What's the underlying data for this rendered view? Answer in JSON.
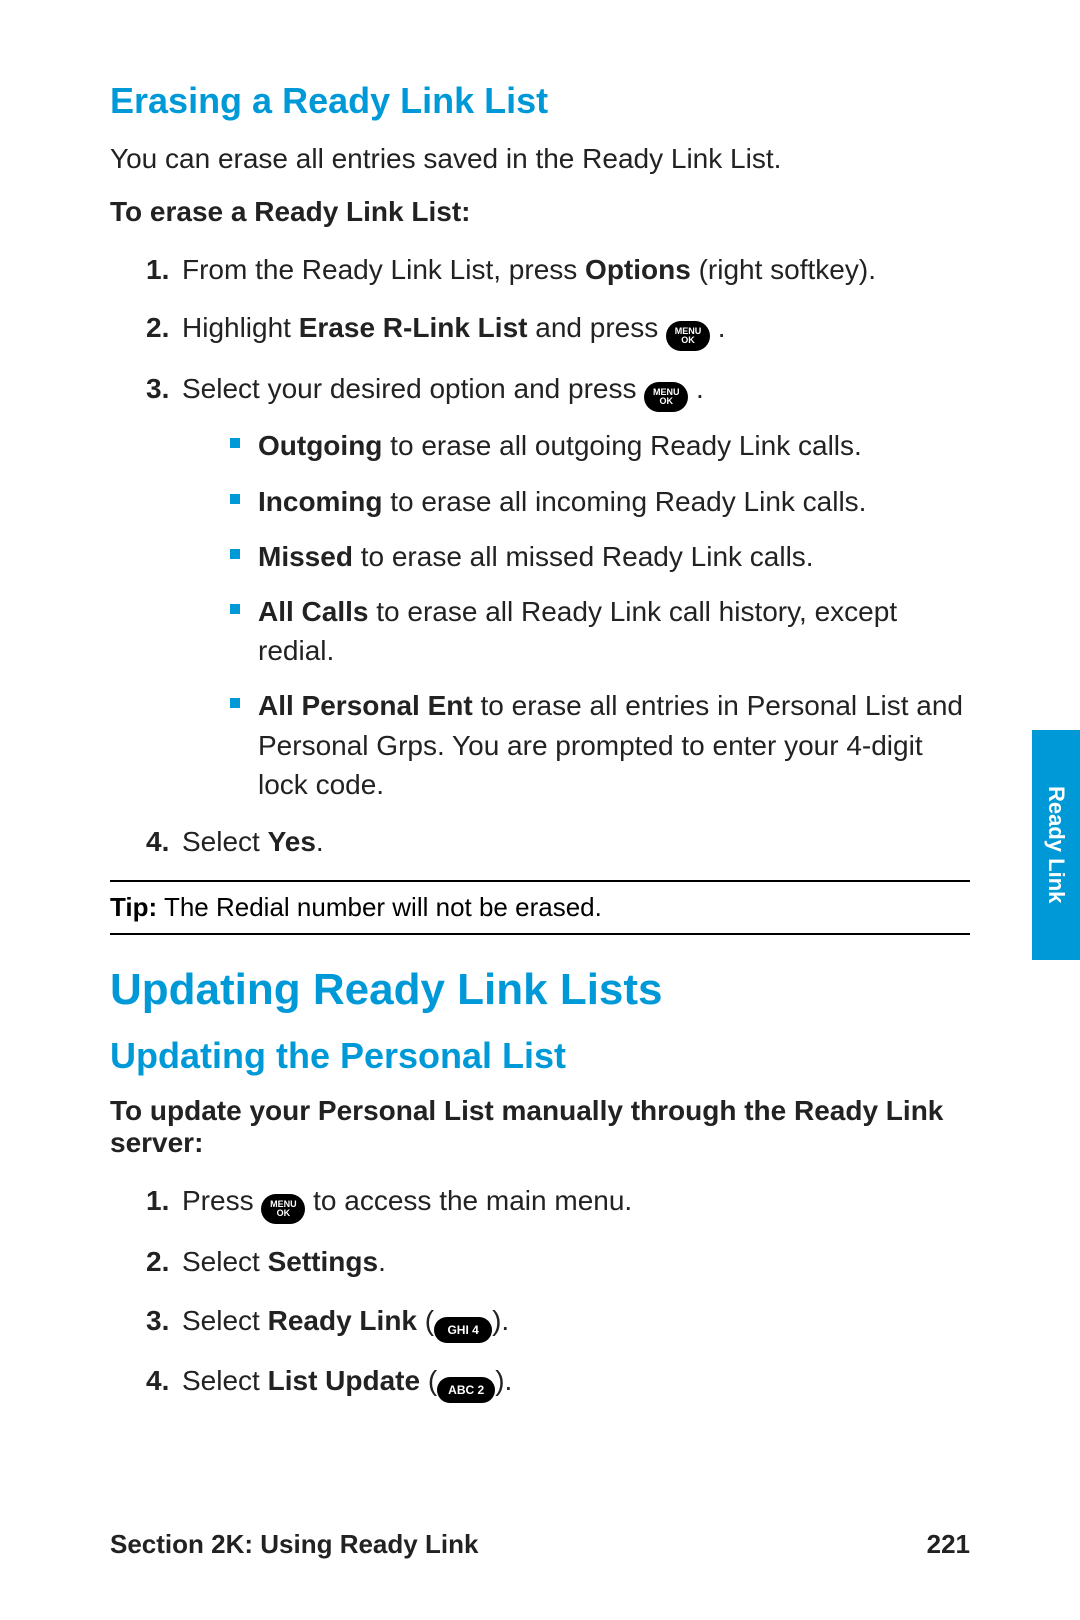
{
  "section1": {
    "heading": "Erasing a Ready Link List",
    "intro": "You can erase all entries saved in the Ready Link List.",
    "task_label": "To erase a Ready Link List:",
    "steps": {
      "n1": "1.",
      "n2": "2.",
      "n3": "3.",
      "n4": "4.",
      "s1a": "From the Ready Link List, press ",
      "s1b": "Options",
      "s1c": " (right softkey).",
      "s2a": "Highlight ",
      "s2b": "Erase R-Link List",
      "s2c": " and press ",
      "s3a": "Select your desired option and press ",
      "s4a": "Select ",
      "s4b": "Yes",
      "s4c": "."
    },
    "bullets": {
      "b1a": "Outgoing",
      "b1b": " to erase all outgoing Ready Link calls.",
      "b2a": "Incoming",
      "b2b": " to erase all incoming Ready Link calls.",
      "b3a": "Missed",
      "b3b": " to erase all missed Ready Link calls.",
      "b4a": "All Calls",
      "b4b": " to erase all Ready Link call history, except redial.",
      "b5a": "All Personal Ent",
      "b5b": " to erase all entries in Personal List and Personal Grps. You are prompted to enter your 4-digit lock code."
    },
    "tip_label": "Tip:",
    "tip_text": " The Redial number will not be erased."
  },
  "section2": {
    "main_heading": "Updating Ready Link Lists",
    "sub_heading": "Updating the Personal List",
    "task_label": "To update your Personal List manually through the Ready Link server:",
    "steps": {
      "n1": "1.",
      "n2": "2.",
      "n3": "3.",
      "n4": "4.",
      "s1a": "Press ",
      "s1b": " to access the main menu.",
      "s2a": "Select ",
      "s2b": "Settings",
      "s2c": ".",
      "s3a": "Select ",
      "s3b": "Ready Link",
      "s3c": " (",
      "s3d": ").",
      "s4a": "Select ",
      "s4b": "List Update",
      "s4c": " (",
      "s4d": ")."
    }
  },
  "keys": {
    "menu": "MENU",
    "ok": "OK",
    "ghi4": "GHI 4",
    "abc2": "ABC 2"
  },
  "sideTab": "Ready Link",
  "footer": {
    "left": "Section 2K: Using Ready Link",
    "right": "221"
  }
}
